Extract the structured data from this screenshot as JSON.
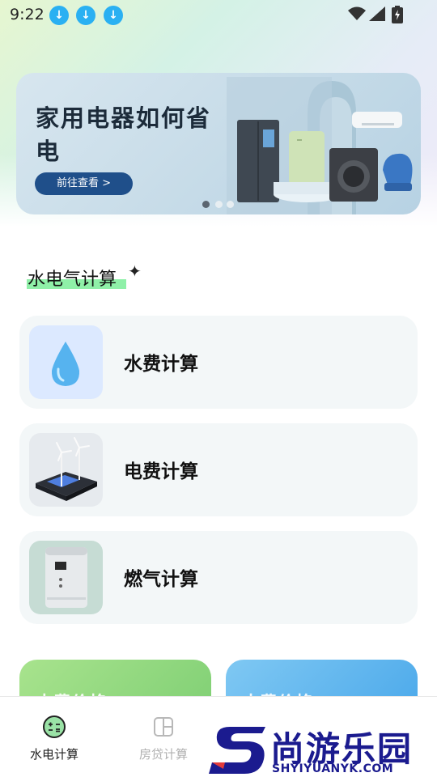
{
  "status_bar": {
    "time": "9:22"
  },
  "banner": {
    "title": "家用电器如何省电",
    "button_label": "前往查看 >",
    "dots_total": 3,
    "dots_active_index": 0
  },
  "section": {
    "title": "水电气计算"
  },
  "cards": [
    {
      "label": "水费计算",
      "icon": "water-drop-icon"
    },
    {
      "label": "电费计算",
      "icon": "wind-turbine-icon"
    },
    {
      "label": "燃气计算",
      "icon": "water-heater-icon"
    }
  ],
  "price_cards": [
    {
      "label": "电费价格"
    },
    {
      "label": "水费价格"
    }
  ],
  "tabs": [
    {
      "label": "水电计算",
      "active": true,
      "icon": "calculator-icon"
    },
    {
      "label": "房贷计算",
      "active": false,
      "icon": "house-loan-icon"
    }
  ],
  "watermark": {
    "text": "尚游乐园",
    "sub": "SHYIYUANYK.COM"
  },
  "colors": {
    "accent_blue": "#1f4f8a",
    "highlight_green": "#8ff0a8",
    "status_download_blue": "#2ab0f2",
    "watermark_blue": "#1b1b8f"
  }
}
